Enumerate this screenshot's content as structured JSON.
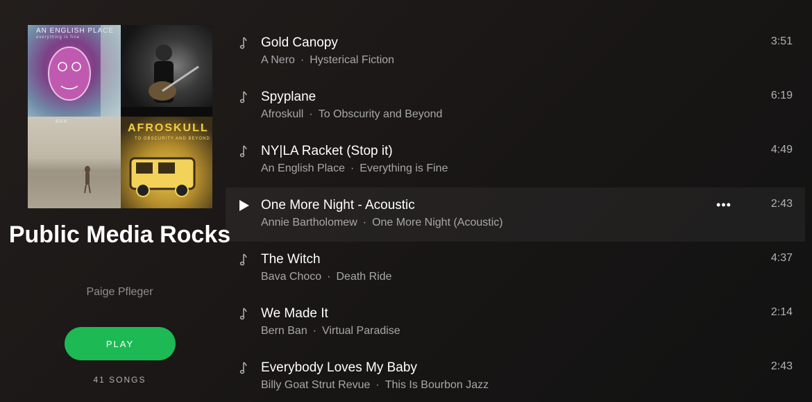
{
  "playlist": {
    "title": "Public Media Rocks",
    "owner": "Paige Pfleger",
    "play_label": "PLAY",
    "song_count": "41 SONGS",
    "cover_tiles": [
      {
        "label": "AN ENGLISH PLACE",
        "sub": "everything is fine"
      },
      {
        "label": "",
        "sub": ""
      },
      {
        "label": "BAN",
        "sub": ""
      },
      {
        "label": "AFROSKULL",
        "sub": "TO OBSCURITY AND BEYOND"
      }
    ]
  },
  "colors": {
    "accent": "#1db954",
    "background": "#181818",
    "muted_text": "#a8a8a8"
  },
  "tracks": [
    {
      "title": "Gold Canopy",
      "artist": "A Nero",
      "album": "Hysterical Fiction",
      "duration": "3:51",
      "icon": "music-note-icon",
      "active": false
    },
    {
      "title": "Spyplane",
      "artist": "Afroskull",
      "album": "To Obscurity and Beyond",
      "duration": "6:19",
      "icon": "music-note-icon",
      "active": false
    },
    {
      "title": "NY|LA Racket (Stop it)",
      "artist": "An English Place",
      "album": "Everything is Fine",
      "duration": "4:49",
      "icon": "music-note-icon",
      "active": false
    },
    {
      "title": "One More Night - Acoustic",
      "artist": "Annie Bartholomew",
      "album": "One More Night (Acoustic)",
      "duration": "2:43",
      "icon": "play-icon",
      "active": true,
      "more_label": "•••"
    },
    {
      "title": "The Witch",
      "artist": "Bava Choco",
      "album": "Death Ride",
      "duration": "4:37",
      "icon": "music-note-icon",
      "active": false
    },
    {
      "title": "We Made It",
      "artist": "Bern Ban",
      "album": "Virtual Paradise",
      "duration": "2:14",
      "icon": "music-note-icon",
      "active": false
    },
    {
      "title": "Everybody Loves My Baby",
      "artist": "Billy Goat Strut Revue",
      "album": "This Is Bourbon Jazz",
      "duration": "2:43",
      "icon": "music-note-icon",
      "active": false
    }
  ],
  "separator": "·"
}
